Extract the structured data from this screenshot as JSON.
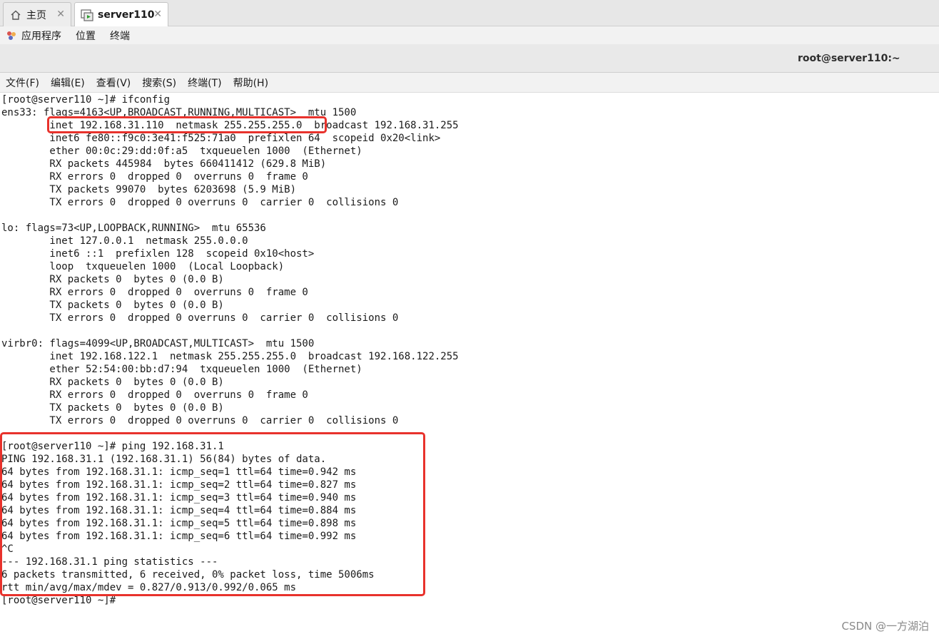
{
  "tabs": [
    {
      "label": "主页",
      "icon": "home-icon"
    },
    {
      "label": "server110",
      "icon": "terminal-app-icon"
    }
  ],
  "topbar": {
    "apps_label": "应用程序",
    "places_label": "位置",
    "terminal_label": "终端"
  },
  "window": {
    "title": "root@server110:~"
  },
  "menu": [
    {
      "label": "文件(F)"
    },
    {
      "label": "编辑(E)"
    },
    {
      "label": "查看(V)"
    },
    {
      "label": "搜索(S)"
    },
    {
      "label": "终端(T)"
    },
    {
      "label": "帮助(H)"
    }
  ],
  "terminal": {
    "lines": [
      "[root@server110 ~]# ifconfig",
      "ens33: flags=4163<UP,BROADCAST,RUNNING,MULTICAST>  mtu 1500",
      "        inet 192.168.31.110  netmask 255.255.255.0  broadcast 192.168.31.255",
      "        inet6 fe80::f9c0:3e41:f525:71a0  prefixlen 64  scopeid 0x20<link>",
      "        ether 00:0c:29:dd:0f:a5  txqueuelen 1000  (Ethernet)",
      "        RX packets 445984  bytes 660411412 (629.8 MiB)",
      "        RX errors 0  dropped 0  overruns 0  frame 0",
      "        TX packets 99070  bytes 6203698 (5.9 MiB)",
      "        TX errors 0  dropped 0 overruns 0  carrier 0  collisions 0",
      "",
      "lo: flags=73<UP,LOOPBACK,RUNNING>  mtu 65536",
      "        inet 127.0.0.1  netmask 255.0.0.0",
      "        inet6 ::1  prefixlen 128  scopeid 0x10<host>",
      "        loop  txqueuelen 1000  (Local Loopback)",
      "        RX packets 0  bytes 0 (0.0 B)",
      "        RX errors 0  dropped 0  overruns 0  frame 0",
      "        TX packets 0  bytes 0 (0.0 B)",
      "        TX errors 0  dropped 0 overruns 0  carrier 0  collisions 0",
      "",
      "virbr0: flags=4099<UP,BROADCAST,MULTICAST>  mtu 1500",
      "        inet 192.168.122.1  netmask 255.255.255.0  broadcast 192.168.122.255",
      "        ether 52:54:00:bb:d7:94  txqueuelen 1000  (Ethernet)",
      "        RX packets 0  bytes 0 (0.0 B)",
      "        RX errors 0  dropped 0  overruns 0  frame 0",
      "        TX packets 0  bytes 0 (0.0 B)",
      "        TX errors 0  dropped 0 overruns 0  carrier 0  collisions 0",
      "",
      "[root@server110 ~]# ping 192.168.31.1",
      "PING 192.168.31.1 (192.168.31.1) 56(84) bytes of data.",
      "64 bytes from 192.168.31.1: icmp_seq=1 ttl=64 time=0.942 ms",
      "64 bytes from 192.168.31.1: icmp_seq=2 ttl=64 time=0.827 ms",
      "64 bytes from 192.168.31.1: icmp_seq=3 ttl=64 time=0.940 ms",
      "64 bytes from 192.168.31.1: icmp_seq=4 ttl=64 time=0.884 ms",
      "64 bytes from 192.168.31.1: icmp_seq=5 ttl=64 time=0.898 ms",
      "64 bytes from 192.168.31.1: icmp_seq=6 ttl=64 time=0.992 ms",
      "^C",
      "--- 192.168.31.1 ping statistics ---",
      "6 packets transmitted, 6 received, 0% packet loss, time 5006ms",
      "rtt min/avg/max/mdev = 0.827/0.913/0.992/0.065 ms",
      "[root@server110 ~]#"
    ]
  },
  "annotation_color": "#e8322c",
  "watermark": "CSDN @一方湖泊"
}
